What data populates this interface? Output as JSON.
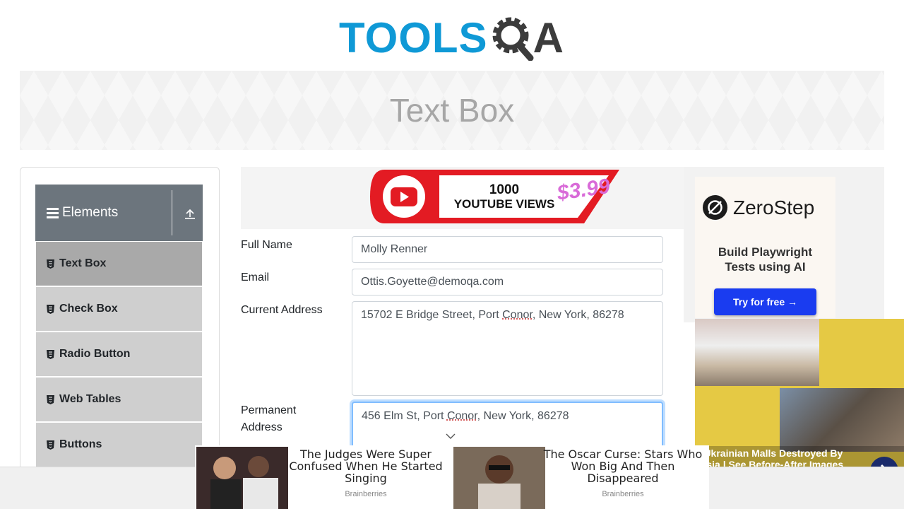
{
  "header": {
    "logo_text_left": "TOOLS",
    "logo_text_right": "A"
  },
  "banner": {
    "title": "Text Box"
  },
  "sidebar": {
    "group_title": "Elements",
    "items": [
      {
        "label": "Text Box",
        "active": true
      },
      {
        "label": "Check Box",
        "active": false
      },
      {
        "label": "Radio Button",
        "active": false
      },
      {
        "label": "Web Tables",
        "active": false
      },
      {
        "label": "Buttons",
        "active": false
      }
    ]
  },
  "ads": {
    "youtube": {
      "line1": "1000",
      "line2": "YOUTUBE VIEWS",
      "price": "$3.99"
    },
    "zerostep": {
      "brand": "ZeroStep",
      "tagline_line1": "Build Playwright",
      "tagline_line2": "Tests using AI",
      "cta": "Try for free →"
    },
    "malls": {
      "caption_line1": "g Ukrainian Malls Destroyed By",
      "caption_line2": "ussia | See Before-After Images"
    },
    "bottom": [
      {
        "title": "The Judges Were Super Confused When He Started Singing",
        "source": "Brainberries"
      },
      {
        "title": "The Oscar Curse: Stars Who Won Big And Then Disappeared",
        "source": "Brainberries"
      }
    ]
  },
  "form": {
    "full_name": {
      "label": "Full Name",
      "value": "Molly Renner"
    },
    "email": {
      "label": "Email",
      "value": "Ottis.Goyette@demoqa.com"
    },
    "current_address": {
      "label": "Current Address",
      "value_pre": "15702 E Bridge Street, Port ",
      "value_word": "Conor",
      "value_post": ", New York, 86278"
    },
    "permanent_address": {
      "label_line1": "Permanent",
      "label_line2": "Address",
      "value_pre": "456 Elm St, Port ",
      "value_word": "Conor",
      "value_post": ", New York, 86278"
    }
  },
  "colors": {
    "brand_blue": "#0f99d6",
    "sidebar_header": "#6c757d",
    "active_item": "#a9a9a9",
    "menu_item": "#cfcfcf",
    "cta_blue": "#1a3cf0"
  }
}
